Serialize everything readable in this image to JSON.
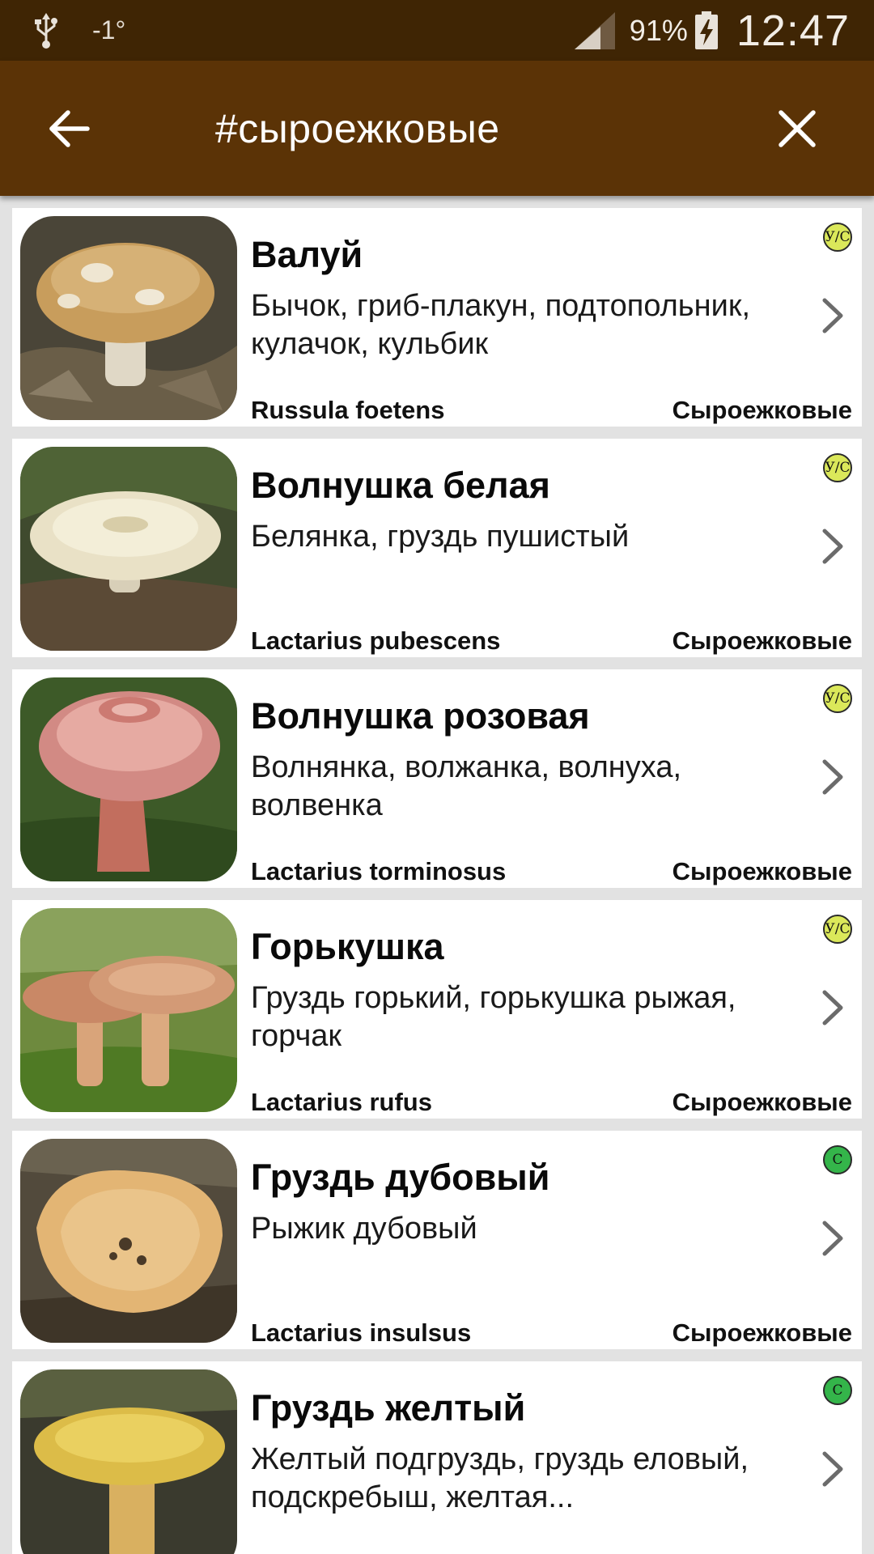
{
  "status_bar": {
    "temperature": "-1°",
    "battery_percent": "91%",
    "time": "12:47",
    "icons": [
      "usb-icon",
      "signal-icon",
      "battery-charging-icon"
    ]
  },
  "app_bar": {
    "title": "#сыроежковые",
    "back_icon": "arrow-back-icon",
    "close_icon": "close-icon"
  },
  "colors": {
    "status_bar": "#3f2504",
    "app_bar": "#5b3306",
    "list_background": "#e2e2e2",
    "badge_conditional": "#dbe85a",
    "badge_edible": "#34b54a"
  },
  "items": [
    {
      "name": "Валуй",
      "aliases": "Бычок, гриб-плакун, подтопольник, кулачок, кульбик",
      "latin": "Russula foetens",
      "family": "Сыроежковые",
      "badge": "У/С",
      "badge_color": "#dbe85a",
      "image": "mushroom-valui-image"
    },
    {
      "name": "Волнушка белая",
      "aliases": "Белянка, груздь пушистый",
      "latin": "Lactarius pubescens",
      "family": "Сыроежковые",
      "badge": "У/С",
      "badge_color": "#dbe85a",
      "image": "mushroom-white-volnushka-image"
    },
    {
      "name": "Волнушка розовая",
      "aliases": "Волнянка, волжанка, волнуха, волвенка",
      "latin": "Lactarius torminosus",
      "family": "Сыроежковые",
      "badge": "У/С",
      "badge_color": "#dbe85a",
      "image": "mushroom-pink-volnushka-image"
    },
    {
      "name": "Горькушка",
      "aliases": "Груздь горький, горькушка рыжая, горчак",
      "latin": "Lactarius rufus",
      "family": "Сыроежковые",
      "badge": "У/С",
      "badge_color": "#dbe85a",
      "image": "mushroom-gorkushka-image"
    },
    {
      "name": "Груздь дубовый",
      "aliases": "Рыжик дубовый",
      "latin": "Lactarius insulsus",
      "family": "Сыроежковые",
      "badge": "С",
      "badge_color": "#34b54a",
      "image": "mushroom-oak-gruzd-image"
    },
    {
      "name": "Груздь желтый",
      "aliases": "Желтый подгруздь, груздь еловый, подскребыш, желтая...",
      "latin": "",
      "family": "",
      "badge": "С",
      "badge_color": "#34b54a",
      "image": "mushroom-yellow-gruzd-image"
    }
  ]
}
